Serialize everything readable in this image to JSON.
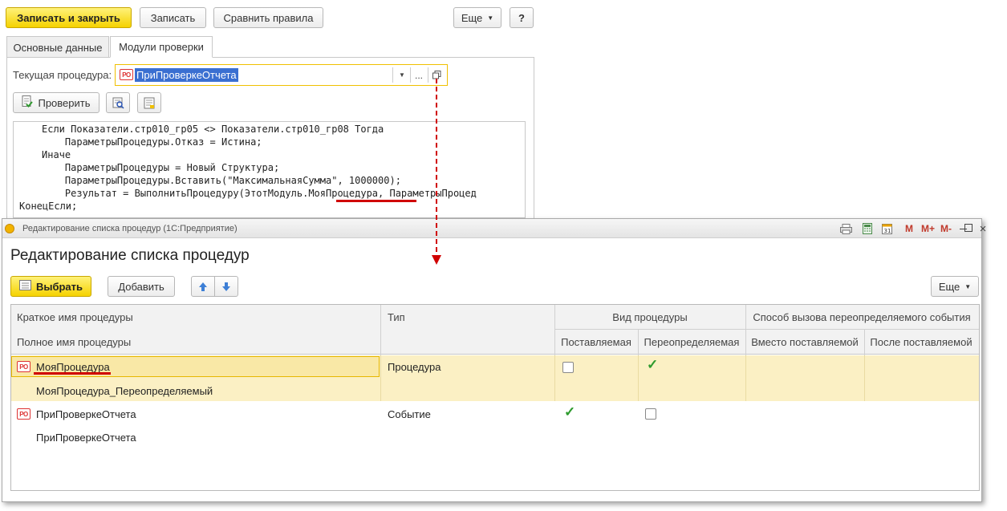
{
  "toolbar": {
    "save_close": "Записать и закрыть",
    "save": "Записать",
    "compare": "Сравнить правила",
    "more": "Еще",
    "help": "?"
  },
  "tabs": [
    "Основные данные",
    "Модули проверки"
  ],
  "procedure_field": {
    "label": "Текущая процедура:",
    "value": "ПриПроверкеОтчета",
    "ellipsis": "..."
  },
  "check_button": "Проверить",
  "code_lines": [
    "Если Показатели.стр010_гр05 <> Показатели.стр010_гр08 Тогда",
    "    ПараметрыПроцедуры.Отказ = Истина;",
    "Иначе",
    "    ПараметрыПроцедуры = Новый Структура;",
    "    ПараметрыПроцедуры.Вставить(\"МаксимальнаяСумма\", 1000000);",
    "    Результат = ВыполнитьПроцедуру(ЭтотМодуль.МояПроцедура, ПараметрыПроцед",
    "КонецЕсли;"
  ],
  "dialog": {
    "window_title": "Редактирование списка процедур  (1С:Предприятие)",
    "title": "Редактирование списка процедур",
    "win_buttons": [
      "M",
      "M+",
      "M-"
    ],
    "choose": "Выбрать",
    "add": "Добавить",
    "more": "Еще"
  },
  "table": {
    "headers": {
      "short_name": "Краткое имя процедуры",
      "full_name": "Полное имя процедуры",
      "type": "Тип",
      "kind": "Вид процедуры",
      "kind_supplied": "Поставляемая",
      "kind_overridable": "Переопределяемая",
      "call_method": "Способ вызова переопределяемого события",
      "instead": "Вместо поставляемой",
      "after": "После поставляемой"
    },
    "rows": [
      {
        "short": "МояПроцедура",
        "full": "МояПроцедура_Переопределяемый",
        "type": "Процедура",
        "supplied": false,
        "overridable": true
      },
      {
        "short": "ПриПроверкеОтчета",
        "full": "ПриПроверкеОтчета",
        "type": "Событие",
        "supplied": true,
        "overridable": false
      }
    ]
  },
  "badge": "РО",
  "colors": {
    "accent_yellow": "#f5d200",
    "selected_row": "#fbf0c4",
    "annotation_red": "#d00000",
    "check_green": "#2e9b2e"
  }
}
